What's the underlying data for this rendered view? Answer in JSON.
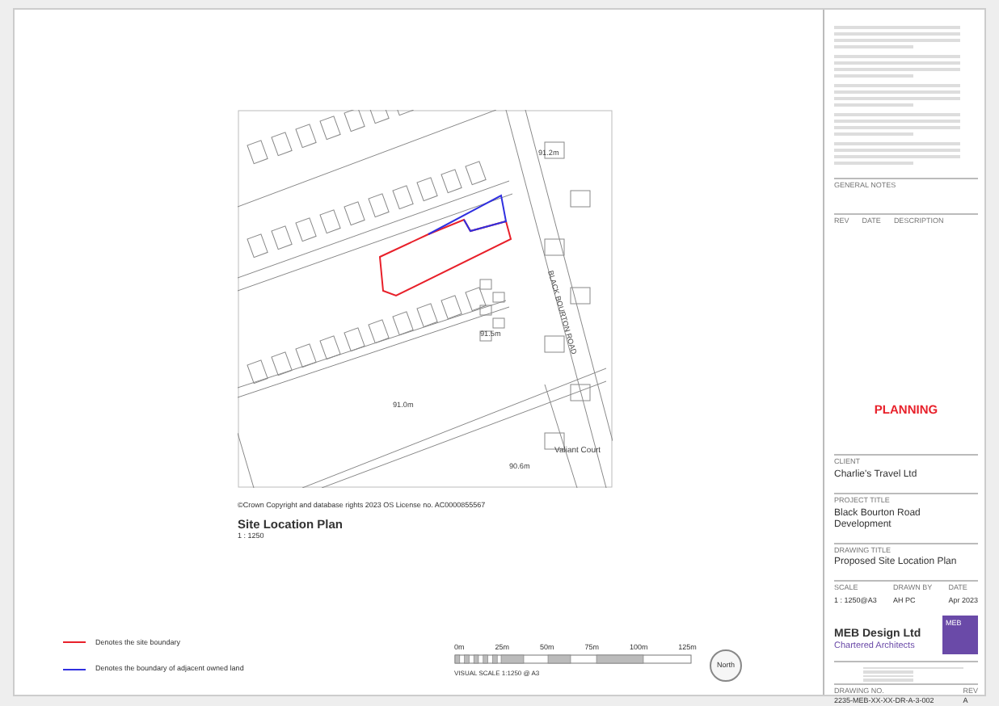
{
  "map": {
    "labels": [
      {
        "kind": "spot",
        "text": "91.2m"
      },
      {
        "kind": "road",
        "text": "BLACK BOURTON ROAD"
      },
      {
        "kind": "spot",
        "text": "91.5m"
      },
      {
        "kind": "spot",
        "text": "91.0m"
      },
      {
        "kind": "spot",
        "text": "90.6m"
      },
      {
        "kind": "place",
        "text": "Valiant Court"
      }
    ],
    "copyright": "©Crown Copyright and database rights 2023 OS License no. AC0000855567"
  },
  "plan": {
    "title": "Site Location Plan",
    "scale": "1 : 1250"
  },
  "legend": [
    {
      "label": "Denotes the site boundary",
      "color": "#e8202a"
    },
    {
      "label": "Denotes the boundary of adjacent owned land",
      "color": "#3030e0"
    }
  ],
  "scale_bar": {
    "ticks": [
      "0m",
      "25m",
      "50m",
      "75m",
      "100m",
      "125m"
    ],
    "caption": "VISUAL SCALE 1:1250 @ A3"
  },
  "north": "North",
  "title_block": {
    "notes_heading": "GENERAL NOTES",
    "revision_columns": [
      "REV",
      "DATE",
      "DESCRIPTION"
    ],
    "status": "PLANNING",
    "fields": [
      {
        "label": "CLIENT",
        "value": "Charlie's Travel Ltd"
      },
      {
        "label": "PROJECT TITLE",
        "value": "Black Bourton Road Development"
      },
      {
        "label": "DRAWING TITLE",
        "value": "Proposed Site Location Plan"
      }
    ],
    "details": [
      {
        "label": "SCALE",
        "value": "1 : 1250@A3"
      },
      {
        "label": "DRAWN BY",
        "value": "AH PC"
      },
      {
        "label": "DATE",
        "value": "Apr 2023"
      }
    ],
    "company": {
      "name": "MEB Design Ltd",
      "tagline": "Chartered Architects",
      "logo_text": "MEB"
    },
    "drawing_no": {
      "label": "DRAWING NO.",
      "value": "2235-MEB-XX-XX-DR-A-3-002"
    },
    "rev": {
      "label": "REV",
      "value": "A"
    }
  }
}
